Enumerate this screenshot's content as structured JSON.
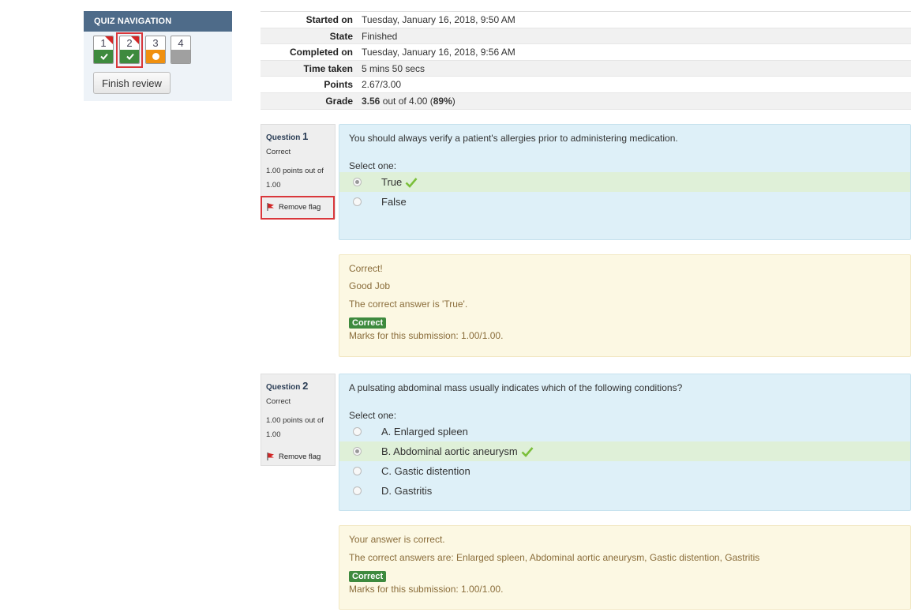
{
  "nav": {
    "title": "QUIZ NAVIGATION",
    "questions": [
      {
        "num": "1",
        "state": "correct",
        "flagged": true
      },
      {
        "num": "2",
        "state": "correct",
        "flagged": true
      },
      {
        "num": "3",
        "state": "partial",
        "flagged": false
      },
      {
        "num": "4",
        "state": "notanswered",
        "flagged": false
      }
    ],
    "finish_label": "Finish review"
  },
  "summary": {
    "started_label": "Started on",
    "started_value": "Tuesday, January 16, 2018, 9:50 AM",
    "state_label": "State",
    "state_value": "Finished",
    "completed_label": "Completed on",
    "completed_value": "Tuesday, January 16, 2018, 9:56 AM",
    "time_label": "Time taken",
    "time_value": "5 mins 50 secs",
    "points_label": "Points",
    "points_value": "2.67/3.00",
    "grade_label": "Grade",
    "grade_score": "3.56",
    "grade_rest": "out of 4.00 (",
    "grade_pct": "89%",
    "grade_close": ")"
  },
  "q1": {
    "label": "Question",
    "num": "1",
    "status": "Correct",
    "points_line1": "1.00 points out of",
    "points_line2": "1.00",
    "flag_label": "Remove flag",
    "text": "You should always verify a patient's allergies prior to administering medication.",
    "prompt": "Select one:",
    "options": [
      {
        "label": "True",
        "selected": true,
        "correct": true
      },
      {
        "label": "False",
        "selected": false,
        "correct": false
      }
    ],
    "fb_general": "Correct!",
    "fb_specific": "Good Job",
    "fb_right": "The correct answer is 'True'.",
    "badge": "Correct",
    "marks": "Marks for this submission: 1.00/1.00."
  },
  "q2": {
    "label": "Question",
    "num": "2",
    "status": "Correct",
    "points_line1": "1.00 points out of",
    "points_line2": "1.00",
    "flag_label": "Remove flag",
    "text": "A pulsating abdominal mass usually indicates which of the following conditions?",
    "prompt": "Select one:",
    "options": [
      {
        "label": "A. Enlarged spleen",
        "selected": false,
        "correct": false
      },
      {
        "label": "B. Abdominal aortic aneurysm",
        "selected": true,
        "correct": true
      },
      {
        "label": "C. Gastic distention",
        "selected": false,
        "correct": false
      },
      {
        "label": "D. Gastritis",
        "selected": false,
        "correct": false
      }
    ],
    "fb_general": "Your answer is correct.",
    "fb_right": "The correct answers are: Enlarged spleen, Abdominal aortic aneurysm, Gastic distention, Gastritis",
    "badge": "Correct",
    "marks": "Marks for this submission: 1.00/1.00."
  },
  "colors": {
    "accent": "#4e6b89",
    "correct": "#3e8a3e",
    "partial": "#f0900f",
    "flag": "#d22525"
  }
}
